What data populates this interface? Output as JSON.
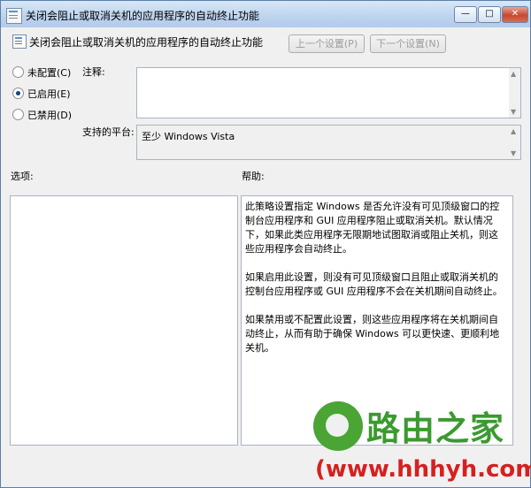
{
  "window": {
    "title": "关闭会阻止或取消关机的应用程序的自动终止功能",
    "controls": {
      "minimize": "—",
      "maximize": "□",
      "close": "✕"
    }
  },
  "header": {
    "title": "关闭会阻止或取消关机的应用程序的自动终止功能",
    "prev_label": "上一个设置(P)",
    "next_label": "下一个设置(N)"
  },
  "state": {
    "options": [
      {
        "label": "未配置(C)",
        "checked": false
      },
      {
        "label": "已启用(E)",
        "checked": true
      },
      {
        "label": "已禁用(D)",
        "checked": false
      }
    ]
  },
  "comment": {
    "label": "注释:",
    "value": ""
  },
  "platform": {
    "label": "支持的平台:",
    "value": "至少 Windows Vista"
  },
  "options_section": {
    "label": "选项:"
  },
  "help": {
    "label": "帮助:",
    "paragraphs": [
      "此策略设置指定 Windows 是否允许没有可见顶级窗口的控制台应用程序和 GUI 应用程序阻止或取消关机。默认情况下，如果此类应用程序无限期地试图取消或阻止关机，则这些应用程序会自动终止。",
      "如果启用此设置，则没有可见顶级窗口且阻止或取消关机的控制台应用程序或 GUI 应用程序不会在关机期间自动终止。",
      "如果禁用或不配置此设置，则这些应用程序将在关机期间自动终止，从而有助于确保 Windows 可以更快速、更顺利地关机。"
    ]
  },
  "watermark": {
    "brand": "路由之家",
    "url": "(www.hhhyh.com)"
  },
  "colors": {
    "titlebar": "#bcd3ee",
    "selected_radio": "#1b3f82",
    "watermark_green": "#3b9a2f",
    "watermark_red": "#d62020"
  }
}
